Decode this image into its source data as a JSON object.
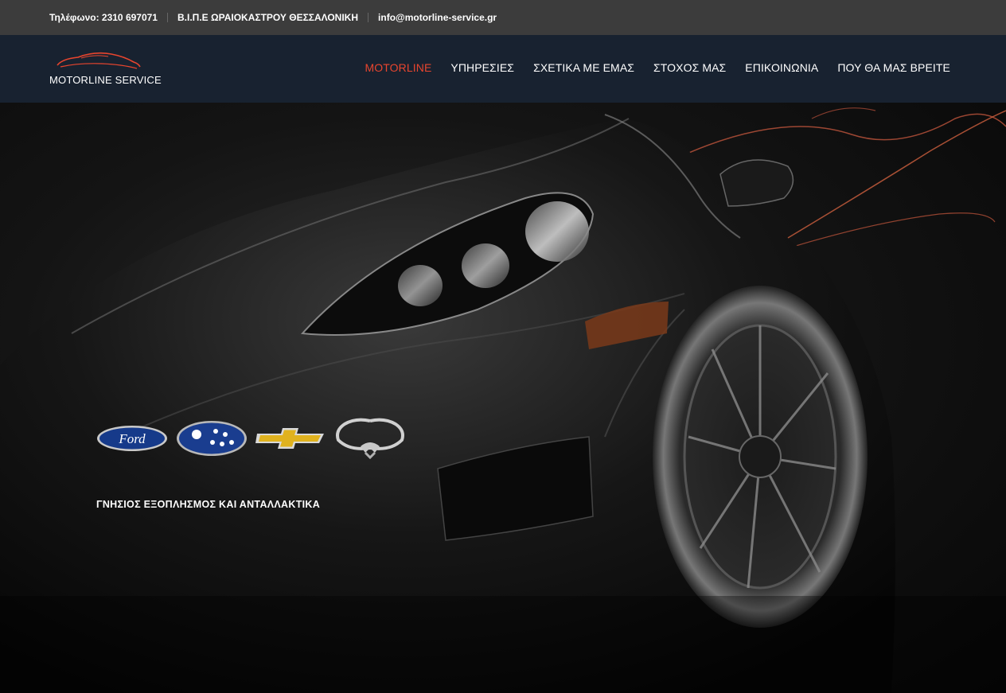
{
  "topbar": {
    "phone": "Τηλέφωνο: 2310 697071",
    "address": "Β.Ι.Π.Ε ΩΡΑΙΟΚΑΣΤΡΟΥ ΘΕΣΣΑΛΟΝΙΚΗ",
    "email": "info@motorline-service.gr"
  },
  "logo": {
    "text": "MOTORLINE SERVICE",
    "icon": "car-silhouette-icon"
  },
  "nav": {
    "items": [
      {
        "label": "MOTORLINE",
        "active": true
      },
      {
        "label": "ΥΠΗΡΕΣΙΕΣ",
        "active": false
      },
      {
        "label": "ΣΧΕΤΙΚΑ ΜΕ ΕΜΑΣ",
        "active": false
      },
      {
        "label": "ΣΤΟΧΟΣ ΜΑΣ",
        "active": false
      },
      {
        "label": "ΕΠΙΚΟΙΝΩΝΙΑ",
        "active": false
      },
      {
        "label": "ΠΟΥ ΘΑ ΜΑΣ ΒΡΕΙΤΕ",
        "active": false
      }
    ]
  },
  "hero": {
    "brands": [
      {
        "name": "Ford",
        "icon": "ford-logo-icon"
      },
      {
        "icon": "subaru-logo-icon"
      },
      {
        "icon": "chevrolet-logo-icon"
      },
      {
        "icon": "ssangyong-logo-icon"
      }
    ],
    "tagline": "ΓΝΗΣΙΟΣ ΕΞΟΠΛΗΣΜΟΣ ΚΑΙ ΑΝΤΑΛΛΑΚΤΙΚΑ"
  },
  "colors": {
    "topbar_bg": "#3c3c3c",
    "navbar_bg": "#182230",
    "accent": "#e8452e",
    "text": "#ffffff"
  }
}
